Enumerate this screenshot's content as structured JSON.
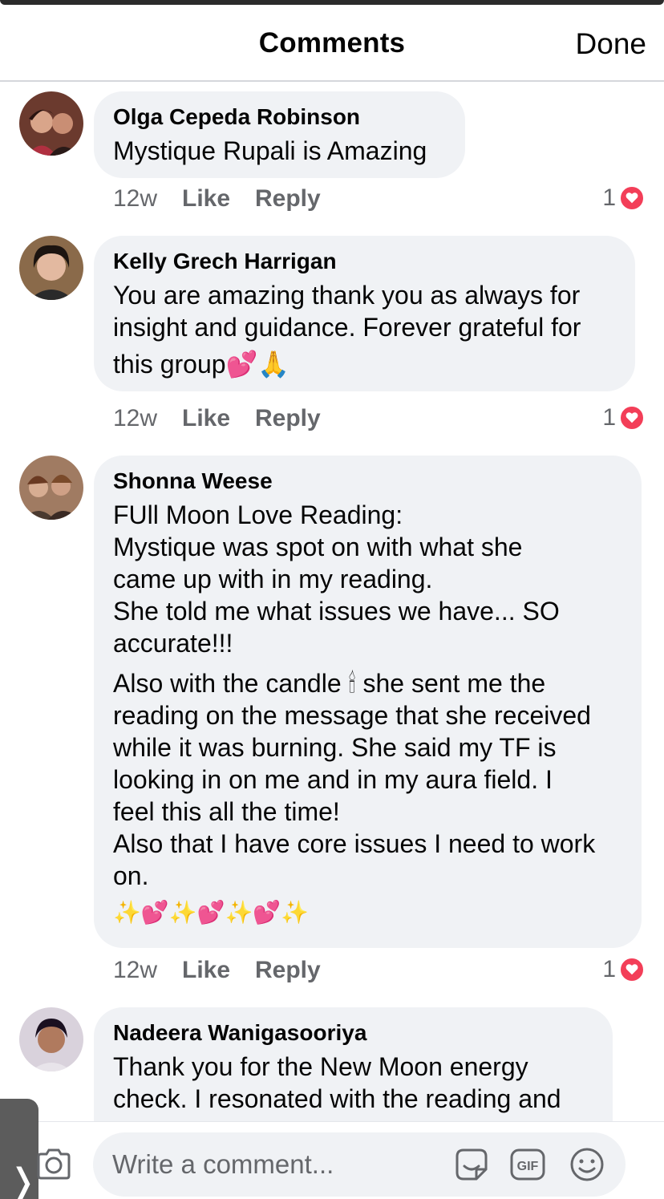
{
  "header": {
    "title": "Comments",
    "done_label": "Done"
  },
  "comments": [
    {
      "author": "Olga Cepeda Robinson",
      "lines": [
        "Mystique Rupali is Amazing"
      ],
      "time": "12w",
      "like": "Like",
      "reply": "Reply",
      "reaction_count": "1"
    },
    {
      "author": "Kelly Grech Harrigan",
      "lines": [
        "You are amazing thank you as always for",
        "insight and guidance. Forever grateful for",
        "this group💕🙏"
      ],
      "time": "12w",
      "like": "Like",
      "reply": "Reply",
      "reaction_count": "1"
    },
    {
      "author": "Shonna Weese",
      "lines": [
        "FUll Moon Love Reading:",
        "Mystique was spot on with what she",
        "came up with in my reading.",
        "She told me what issues we have... SO",
        "accurate!!!"
      ],
      "lines2": [
        "Also with the candle 🕯 she sent me the",
        "reading on the message that she received",
        "while it was burning. She said my TF is",
        "looking in on me and in my aura field. I",
        "feel this all the time!",
        "Also that I have core issues I need to work",
        "on."
      ],
      "emoji_line": "✨💕✨💕✨💕✨",
      "time": "12w",
      "like": "Like",
      "reply": "Reply",
      "reaction_count": "1"
    },
    {
      "author": "Nadeera Wanigasooriya",
      "lines": [
        "Thank you for the New Moon energy",
        "check. I resonated with the reading and"
      ]
    }
  ],
  "composer": {
    "placeholder": "Write a comment..."
  },
  "icons": [
    "camera-icon",
    "sticker-icon",
    "gif-icon",
    "smile-icon",
    "heart-icon",
    "chevron-right-icon"
  ],
  "colors": {
    "bubble": "#f0f2f5",
    "meta": "#65676b",
    "heart": "#f33e58"
  }
}
